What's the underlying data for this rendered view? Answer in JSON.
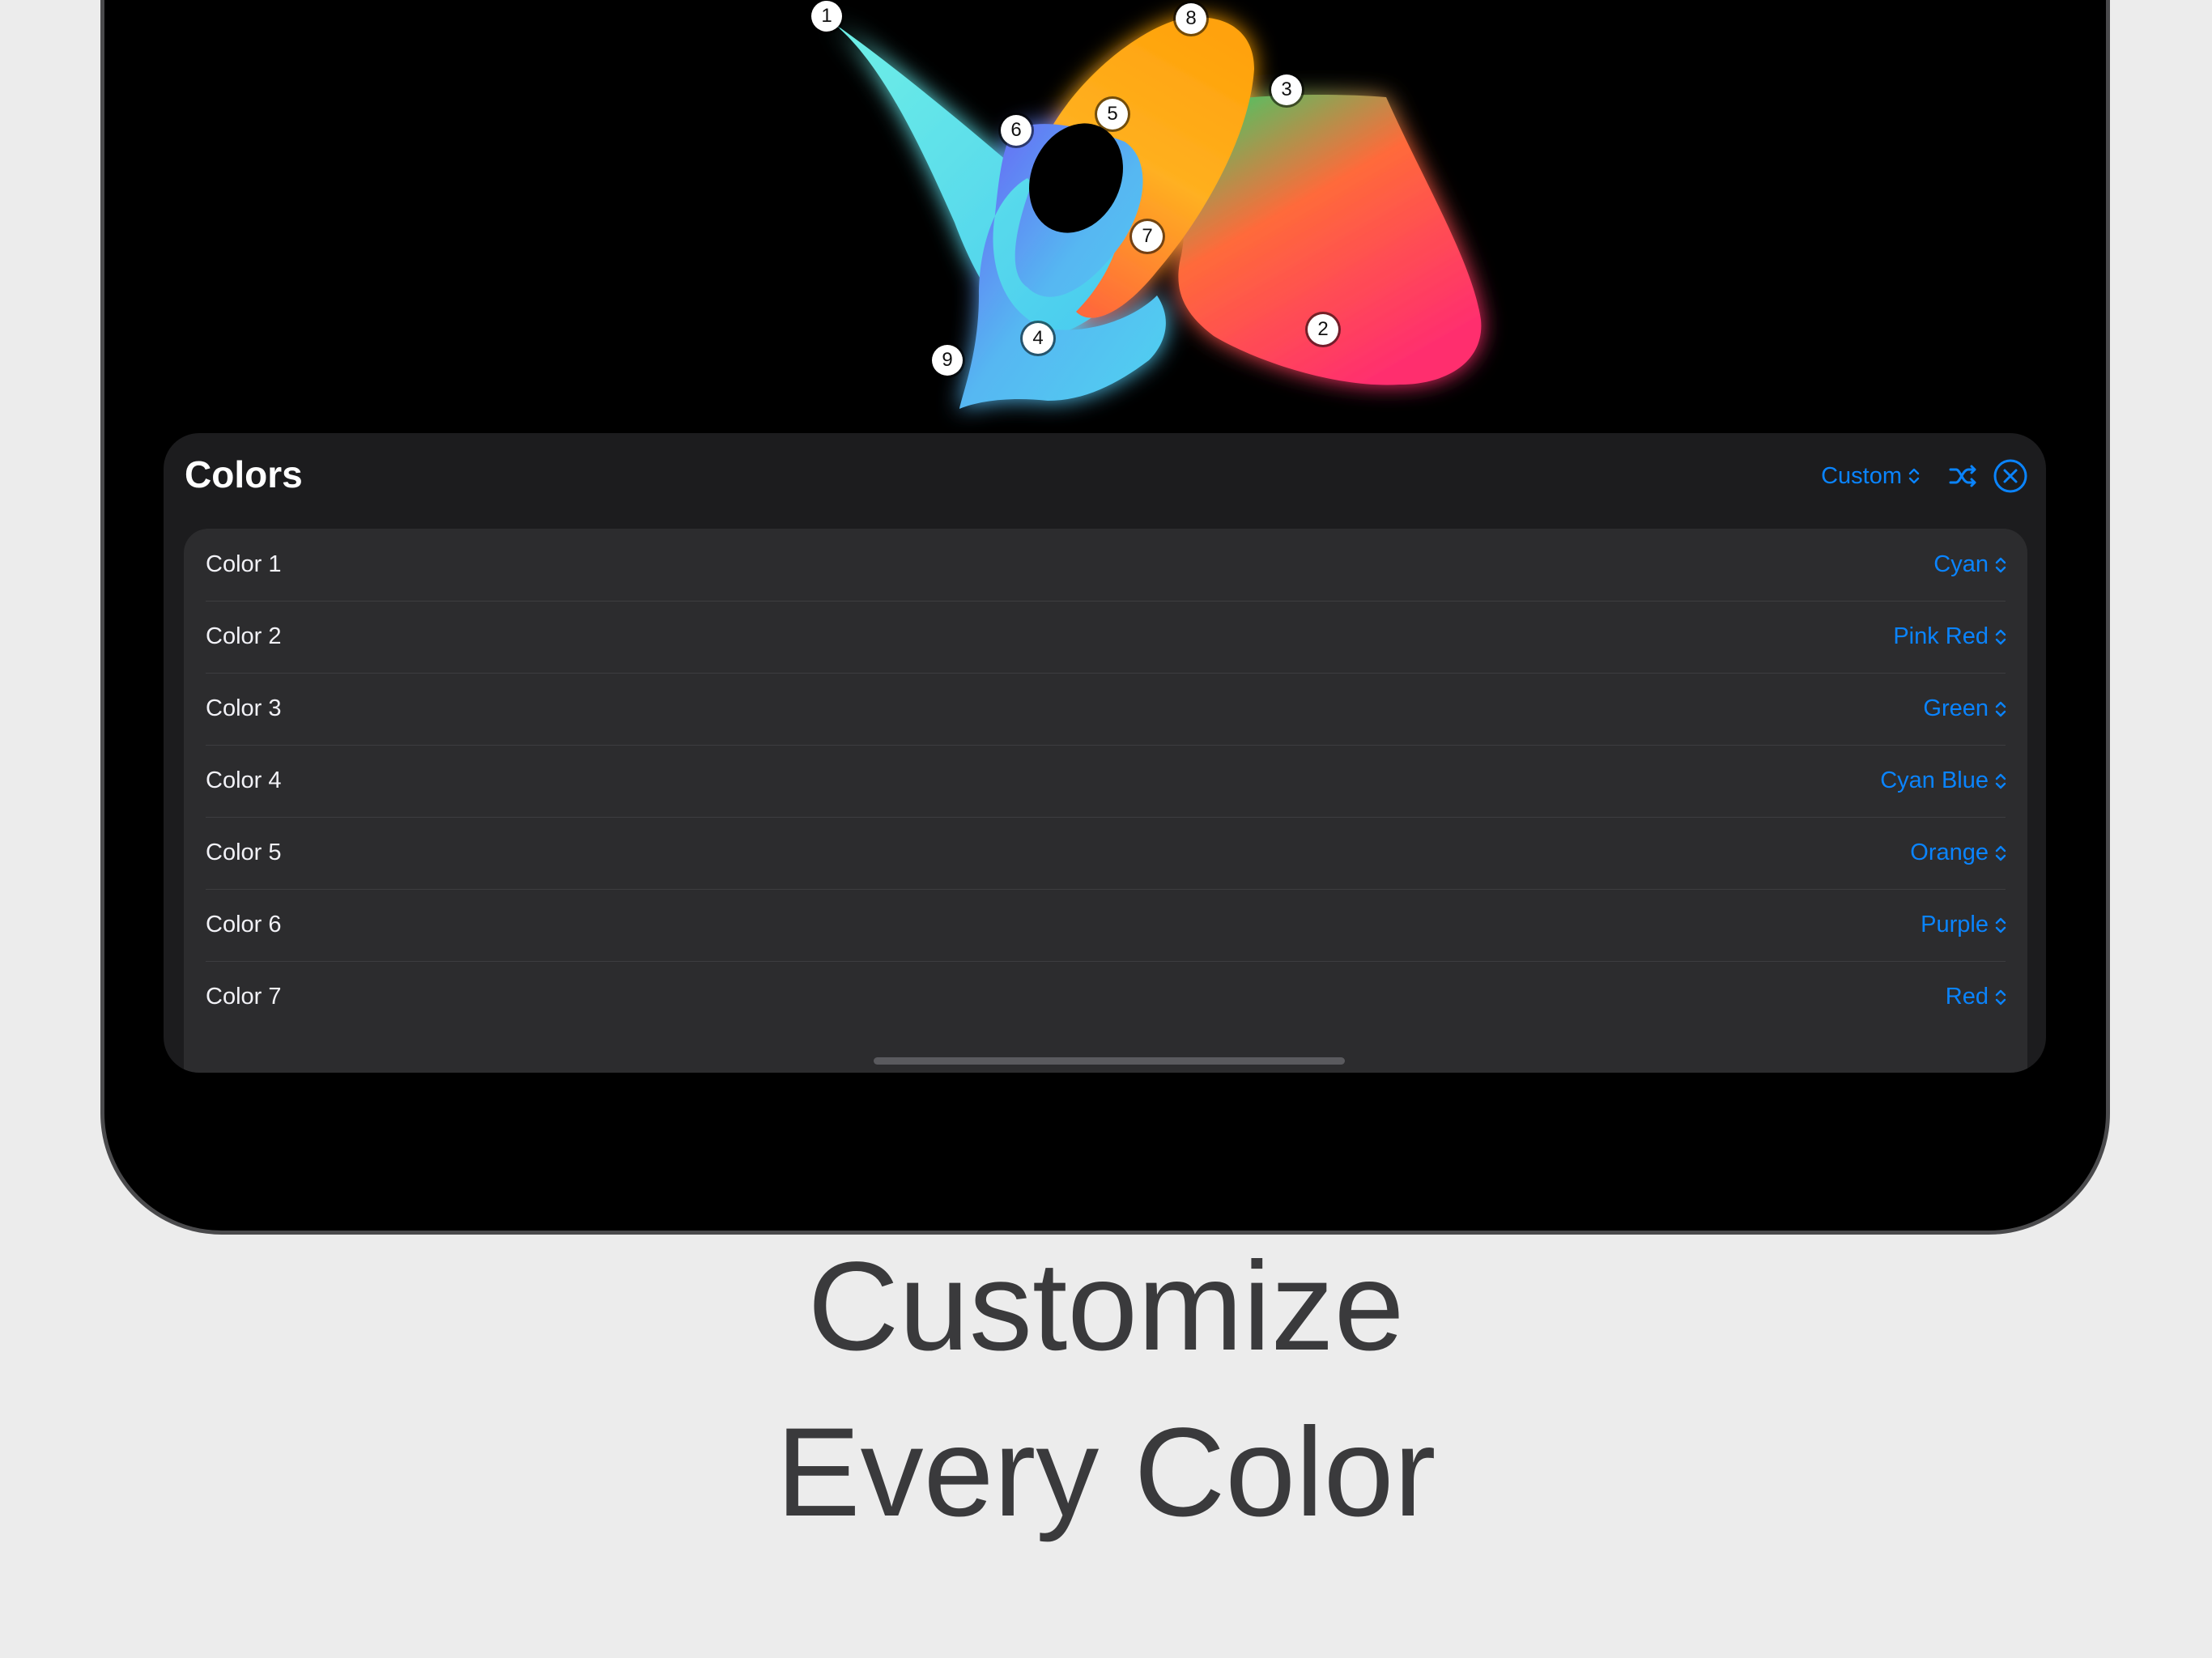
{
  "canvas": {
    "control_points": [
      "1",
      "2",
      "3",
      "4",
      "5",
      "6",
      "7",
      "8",
      "9"
    ]
  },
  "panel": {
    "title": "Colors",
    "preset_label": "Custom",
    "shuffle_icon": "shuffle-icon",
    "close_icon": "xmark-circle-icon",
    "rows": [
      {
        "label": "Color 1",
        "value": "Cyan",
        "swatch": "#5ee6e4"
      },
      {
        "label": "Color 2",
        "value": "Pink Red",
        "swatch": "#ff3b6b"
      },
      {
        "label": "Color 3",
        "value": "Green",
        "swatch": "#35c759"
      },
      {
        "label": "Color 4",
        "value": "Cyan Blue",
        "swatch": "#52c7f5"
      },
      {
        "label": "Color 5",
        "value": "Orange",
        "swatch": "#ff9f0a"
      },
      {
        "label": "Color 6",
        "value": "Purple",
        "swatch": "#7a5cf5"
      },
      {
        "label": "Color 7",
        "value": "Red",
        "swatch": "#ff453a"
      }
    ]
  },
  "caption": {
    "line1": "Customize",
    "line2": "Every Color"
  },
  "colors": {
    "accent": "#0a84ff",
    "device_background": "#000000",
    "panel_background": "#1c1c1e",
    "list_background": "#2c2c2e",
    "page_background": "#ececec",
    "caption_text": "#3a3a3c"
  }
}
